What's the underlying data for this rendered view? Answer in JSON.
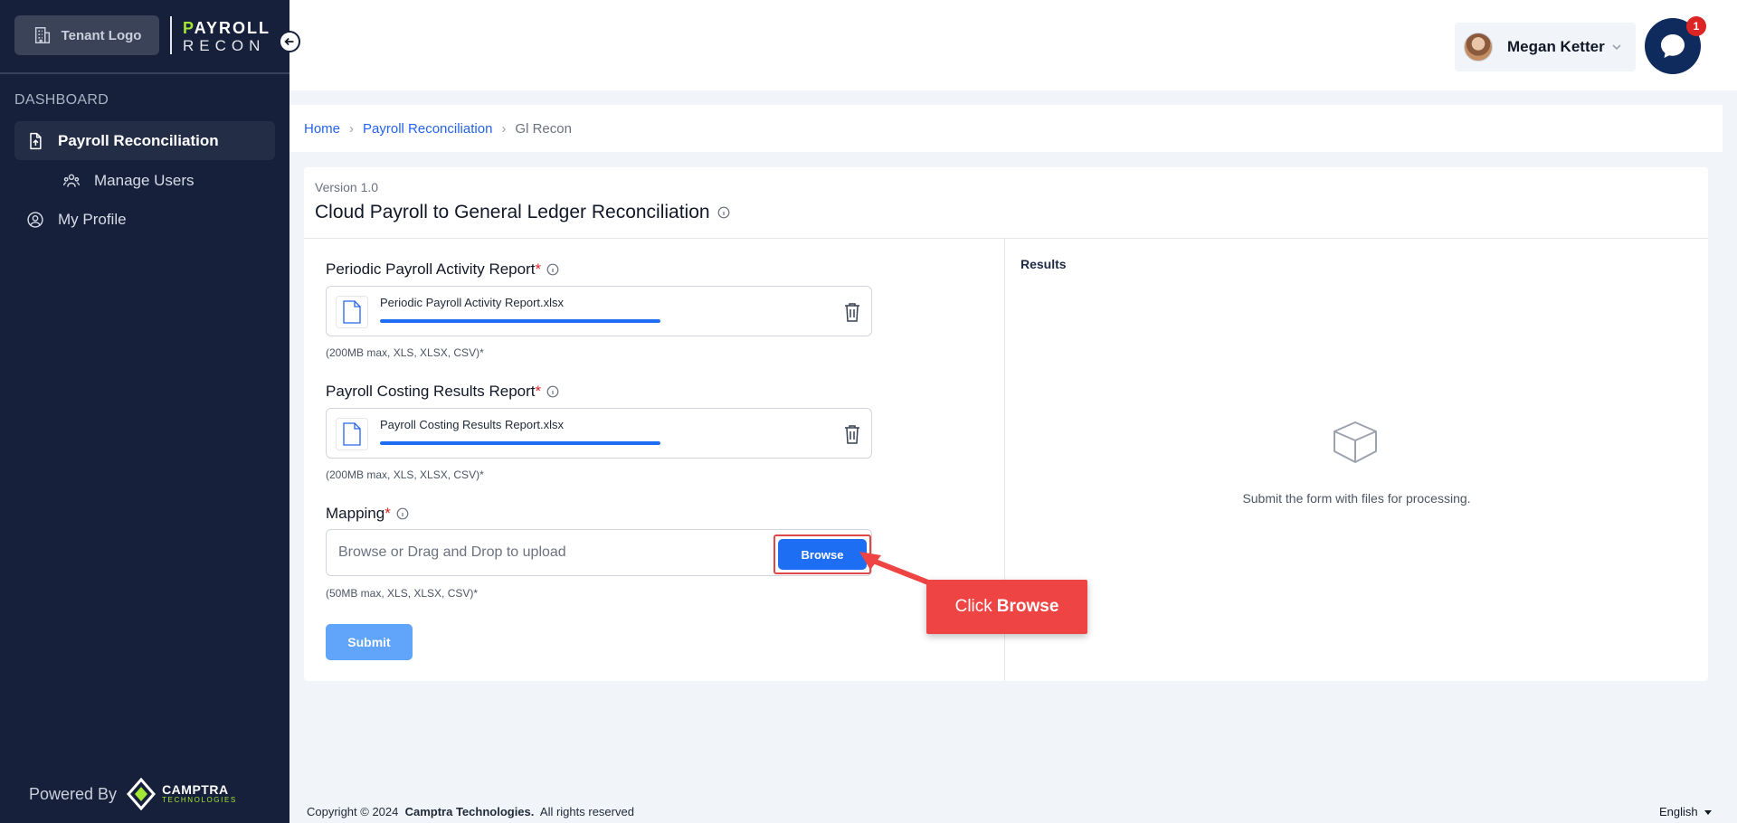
{
  "sidebar": {
    "tenant_logo": "Tenant Logo",
    "app_logo_line1_accent": "P",
    "app_logo_line1_rest": "AYROLL",
    "app_logo_line2": "RECON",
    "section": "DASHBOARD",
    "items": [
      {
        "label": "Payroll Reconciliation",
        "icon": "file-upload-icon"
      },
      {
        "label": "Manage Users",
        "icon": "users-icon"
      },
      {
        "label": "My Profile",
        "icon": "user-circle-icon"
      }
    ],
    "powered_by": "Powered By",
    "powered_brand": "CAMPTRA",
    "powered_brand_sub": "TECHNOLOGIES"
  },
  "header": {
    "user_name": "Megan Ketter",
    "chat_badge": "1"
  },
  "breadcrumb": {
    "home": "Home",
    "parent": "Payroll Reconciliation",
    "current": "Gl Recon"
  },
  "form": {
    "version": "Version 1.0",
    "title": "Cloud Payroll to General Ledger Reconciliation",
    "fields": [
      {
        "label": "Periodic Payroll Activity Report",
        "required": "*",
        "file": "Periodic Payroll Activity Report.xlsx",
        "progress": 1.0,
        "hint": "(200MB max, XLS, XLSX, CSV)*"
      },
      {
        "label": "Payroll Costing Results Report",
        "required": "*",
        "file": "Payroll Costing Results Report.xlsx",
        "progress": 1.0,
        "hint": "(200MB max, XLS, XLSX, CSV)*"
      }
    ],
    "mapping": {
      "label": "Mapping",
      "required": "*",
      "placeholder": "Browse or Drag and Drop to upload",
      "browse": "Browse",
      "hint": "(50MB max, XLS, XLSX, CSV)*"
    },
    "submit": "Submit"
  },
  "results": {
    "title": "Results",
    "empty_message": "Submit the form with files for processing."
  },
  "callout": {
    "prefix": "Click",
    "target": "Browse"
  },
  "footer": {
    "copyright": "Copyright © 2024",
    "company": "Camptra Technologies.",
    "rights": "All rights reserved",
    "language": "English"
  },
  "colors": {
    "sidebar_bg": "#16203a",
    "accent_blue": "#1d6ef2",
    "callout_red": "#ef4444",
    "brand_green": "#a3e635"
  }
}
